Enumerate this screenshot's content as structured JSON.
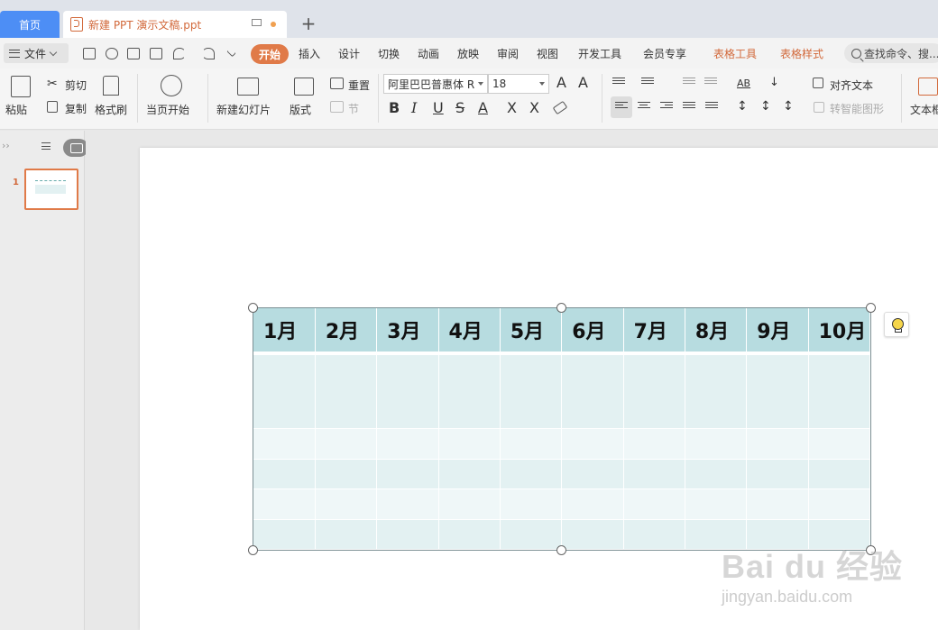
{
  "tabs": {
    "home": "首页",
    "document": "新建 PPT 演示文稿.ppt",
    "add": "+"
  },
  "menu": {
    "file": "文件",
    "start": "开始",
    "items": [
      "插入",
      "设计",
      "切换",
      "动画",
      "放映",
      "审阅",
      "视图",
      "开发工具",
      "会员专享"
    ],
    "table_tools": "表格工具",
    "table_style": "表格样式",
    "search_placeholder": "查找命令、搜..."
  },
  "ribbon": {
    "paste": "粘贴",
    "cut": "剪切",
    "copy": "复制",
    "format_painter": "格式刷",
    "play_from_current": "当页开始",
    "new_slide": "新建幻灯片",
    "layout": "版式",
    "reset": "重置",
    "section": "节",
    "font_name": "阿里巴巴普惠体 R",
    "font_size": "18",
    "align_text": "对齐文本",
    "smart_shape": "转智能图形",
    "textbox": "文本框"
  },
  "sidebar": {
    "slide_number": "1"
  },
  "table": {
    "headers": [
      "1月",
      "2月",
      "3月",
      "4月",
      "5月",
      "6月",
      "7月",
      "8月",
      "9月",
      "10月"
    ],
    "body_rows": 5
  },
  "watermark": {
    "main": "Bai du 经验",
    "sub": "jingyan.baidu.com"
  },
  "colors": {
    "accent": "#e07a48",
    "home_tab": "#4d8ef5",
    "table_header": "#b7dce0",
    "table_band_a": "#e3f1f2",
    "table_band_b": "#eff7f8"
  }
}
